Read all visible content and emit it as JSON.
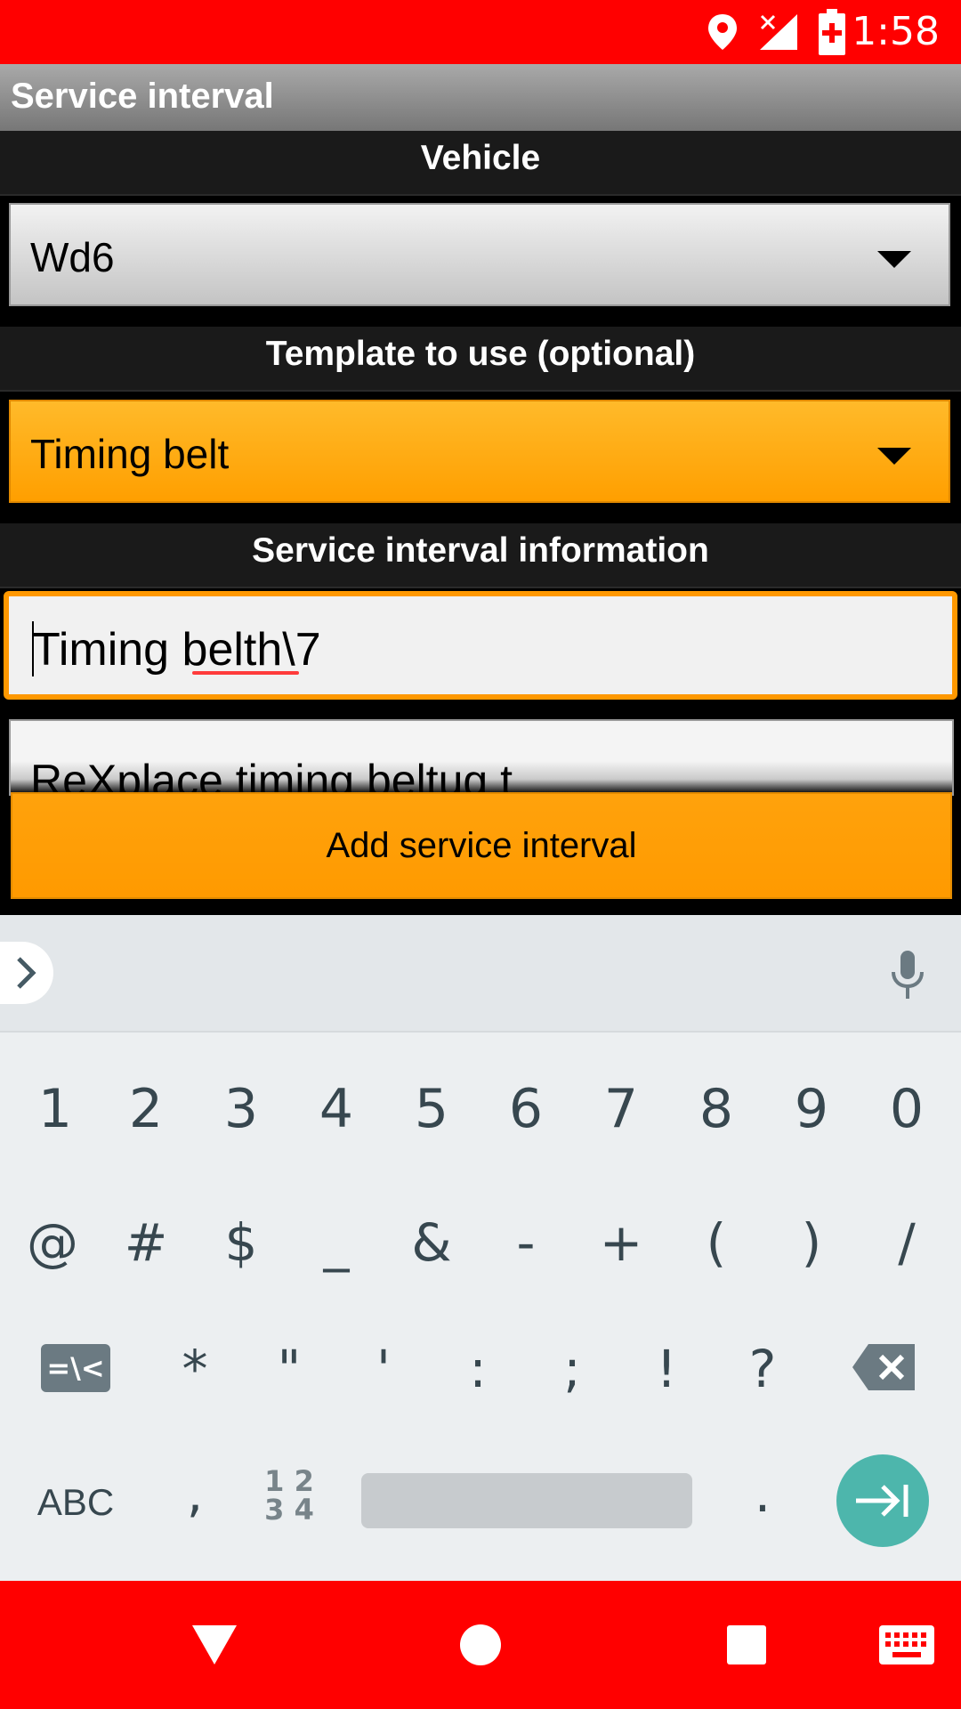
{
  "status_bar": {
    "time": "1:58",
    "icons": [
      "location-icon",
      "no-signal-icon",
      "battery-charging-icon"
    ]
  },
  "app_bar": {
    "title": "Service interval"
  },
  "vehicle_section": {
    "header": "Vehicle",
    "selected": "Wd6"
  },
  "template_section": {
    "header": "Template to use (optional)",
    "selected": "Timing belt"
  },
  "info_section": {
    "header": "Service interval information",
    "title_value": "Timing belth\\7",
    "description_value": "ReXplace timing beltug t"
  },
  "add_button": {
    "label": "Add service interval"
  },
  "keyboard": {
    "number_row": [
      "1",
      "2",
      "3",
      "4",
      "5",
      "6",
      "7",
      "8",
      "9",
      "0"
    ],
    "symbol_row": [
      "@",
      "#",
      "$",
      "_",
      "&",
      "-",
      "+",
      "(",
      ")",
      "/"
    ],
    "third_row": [
      "*",
      "\"",
      "'",
      ":",
      ";",
      "!",
      "?"
    ],
    "more_symbols_label": "=\\<",
    "abc_label": "ABC",
    "comma": ",",
    "numpad_label_top": "1 2",
    "numpad_label_bottom": "3 4",
    "period": "."
  },
  "colors": {
    "status_bar": "#ff0000",
    "accent": "#ff9800",
    "enter_key": "#4db6ac"
  }
}
